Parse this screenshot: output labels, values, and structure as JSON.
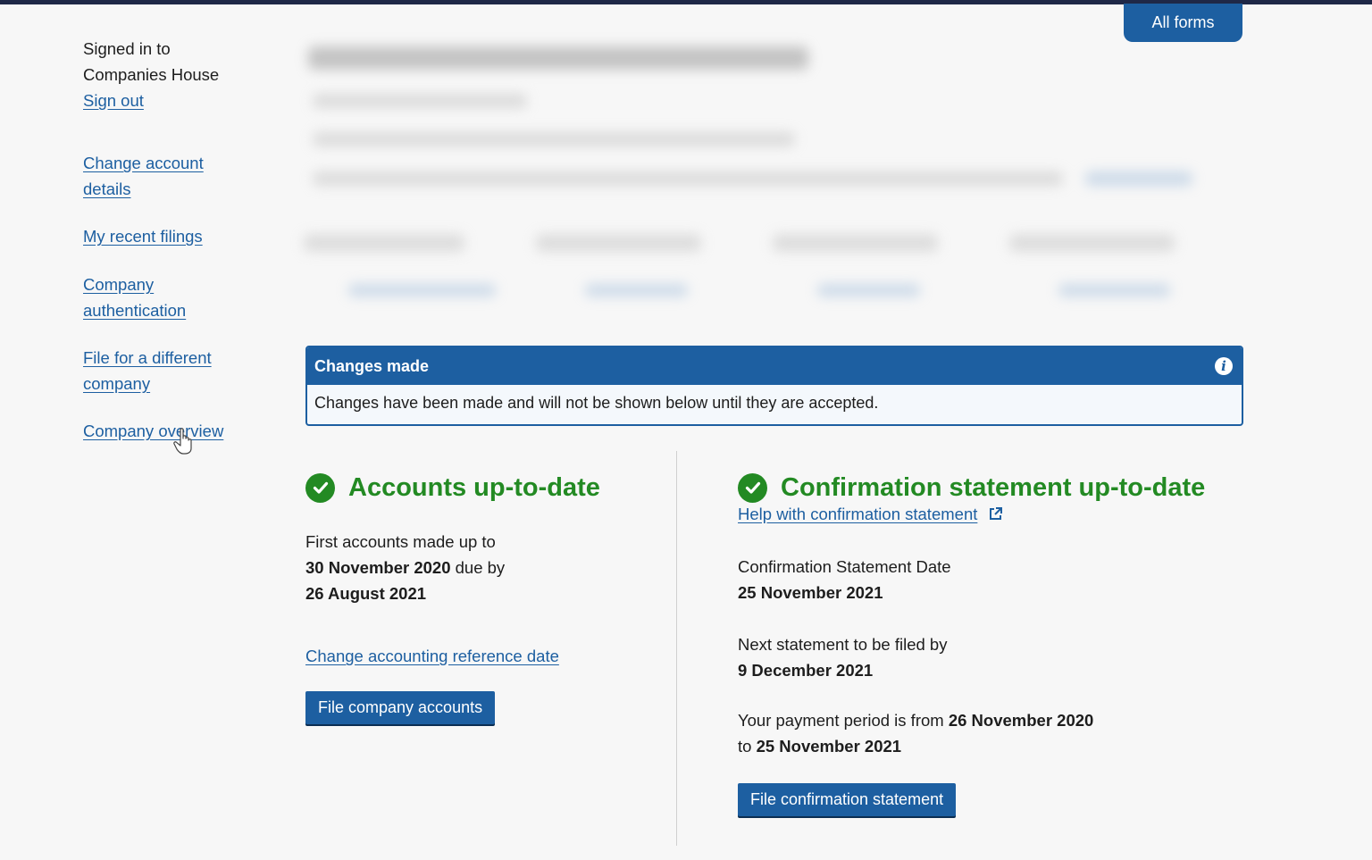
{
  "header": {
    "all_forms_label": "All forms"
  },
  "sidebar": {
    "signed_in_line1": "Signed in to",
    "signed_in_line2": "Companies House",
    "sign_out": "Sign out",
    "nav": [
      {
        "label_lines": [
          "Change account",
          "details"
        ]
      },
      {
        "label_lines": [
          "My recent filings"
        ]
      },
      {
        "label_lines": [
          "Company",
          "authentication"
        ]
      },
      {
        "label_lines": [
          "File for a different",
          "company"
        ]
      },
      {
        "label_lines": [
          "Company overview"
        ]
      }
    ]
  },
  "banner": {
    "title": "Changes made",
    "message": "Changes have been made and will not be shown below until they are accepted.",
    "icon": "info-icon"
  },
  "accounts": {
    "heading": "Accounts up-to-date",
    "line1": "First accounts made up to",
    "made_up_date": "30 November 2020",
    "due_by_label": "due by",
    "due_date": "26 August 2021",
    "change_link": "Change accounting reference date",
    "button": "File company accounts"
  },
  "confirmation": {
    "heading": "Confirmation statement up-to-date",
    "help_link": "Help with confirmation statement",
    "date_label": "Confirmation Statement Date",
    "date_value": "25 November 2021",
    "next_label": "Next statement to be filed by",
    "next_value": "9 December 2021",
    "payment_prefix": "Your payment period is from",
    "payment_from": "26 November 2020",
    "payment_to_label": "to",
    "payment_to": "25 November 2021",
    "button": "File confirmation statement"
  },
  "colors": {
    "brand_blue": "#1d5fa1",
    "success_green": "#238a23",
    "top_bar": "#1f2847"
  }
}
